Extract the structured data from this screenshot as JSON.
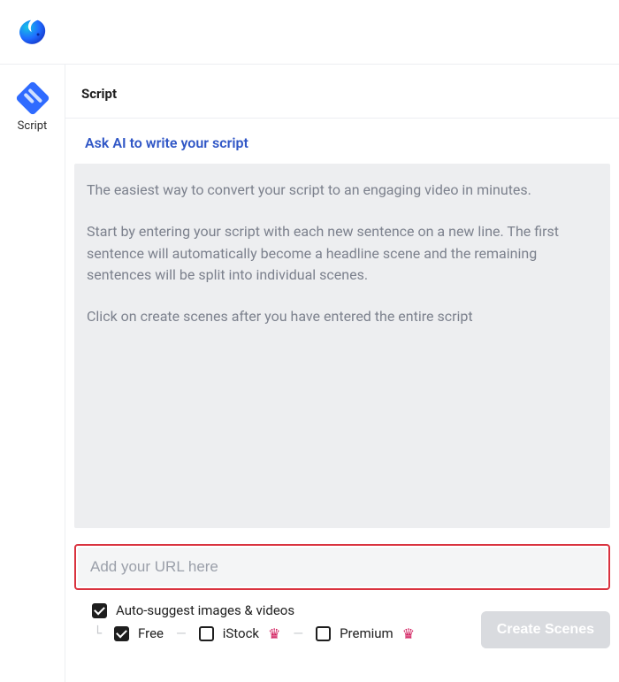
{
  "header": {
    "logo_name": "app-logo"
  },
  "sidebar": {
    "items": [
      {
        "icon": "script-icon",
        "label": "Script"
      }
    ]
  },
  "main": {
    "title": "Script",
    "ai_link": "Ask AI to write your script",
    "script_placeholder_p1": "The easiest way to convert your script to an engaging video in minutes.",
    "script_placeholder_p2": "Start by entering your script with each new sentence on a new line. The first sentence will automatically become a headline scene and the remaining sentences will be split into individual scenes.",
    "script_placeholder_p3": "Click on create scenes after you have entered the entire script",
    "url_placeholder": "Add your URL here",
    "options": {
      "auto_suggest_label": "Auto-suggest images & videos",
      "auto_suggest_checked": true,
      "sources": [
        {
          "label": "Free",
          "checked": true,
          "premium": false
        },
        {
          "label": "iStock",
          "checked": false,
          "premium": true
        },
        {
          "label": "Premium",
          "checked": false,
          "premium": true
        }
      ]
    },
    "create_button": "Create Scenes"
  }
}
